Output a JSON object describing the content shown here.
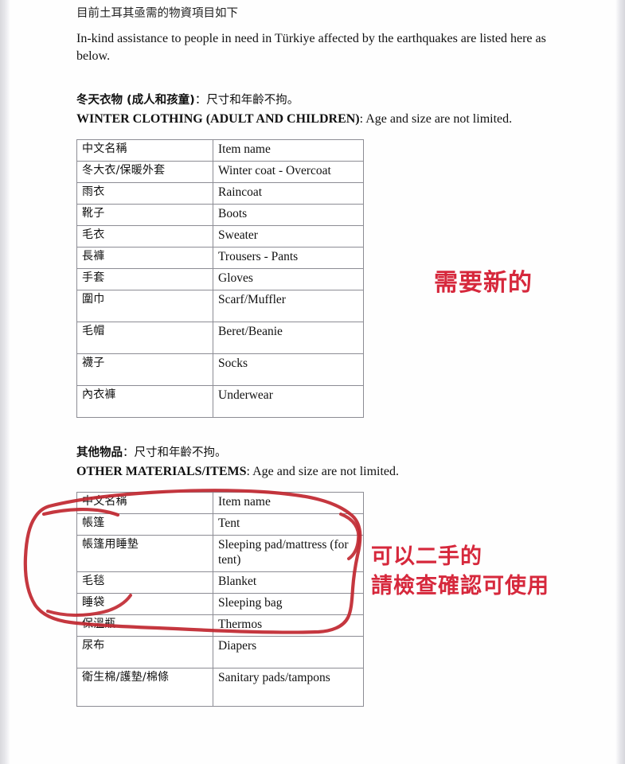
{
  "document": {
    "intro_cn": "目前土耳其亟需的物資項目如下",
    "intro_en": "In-kind assistance to people in need in Türkiye affected by the earthquakes are listed here as below."
  },
  "sections": [
    {
      "heading_cn_bold": "冬天衣物 (成人和孩童)",
      "heading_cn_rest": "：尺寸和年齡不拘。",
      "heading_en_bold": "WINTER CLOTHING (ADULT AND CHILDREN)",
      "heading_en_rest": ": Age and size are not limited.",
      "table": {
        "header": {
          "cn": "中文名稱",
          "en": "Item name"
        },
        "rows": [
          {
            "cn": "冬大衣/保暖外套",
            "en": "Winter coat - Overcoat"
          },
          {
            "cn": "雨衣",
            "en": "Raincoat"
          },
          {
            "cn": "靴子",
            "en": "Boots"
          },
          {
            "cn": "毛衣",
            "en": "Sweater"
          },
          {
            "cn": "長褲",
            "en": "Trousers - Pants"
          },
          {
            "cn": "手套",
            "en": "Gloves"
          },
          {
            "cn": "圍巾",
            "en": "Scarf/Muffler"
          },
          {
            "cn": "毛帽",
            "en": "Beret/Beanie"
          },
          {
            "cn": "襪子",
            "en": "Socks"
          },
          {
            "cn": "內衣褲",
            "en": "Underwear"
          }
        ]
      }
    },
    {
      "heading_cn_bold": "其他物品",
      "heading_cn_rest": "：尺寸和年齡不拘。",
      "heading_en_bold": "OTHER MATERIALS/ITEMS",
      "heading_en_rest": ": Age and size are not limited.",
      "table": {
        "header": {
          "cn": "中文名稱",
          "en": "Item name"
        },
        "rows": [
          {
            "cn": "帳篷",
            "en": "Tent"
          },
          {
            "cn": "帳篷用睡墊",
            "en": "Sleeping pad/mattress (for tent)"
          },
          {
            "cn": "毛毯",
            "en": "Blanket"
          },
          {
            "cn": "睡袋",
            "en": "Sleeping bag"
          },
          {
            "cn": "保溫瓶",
            "en": "Thermos"
          },
          {
            "cn": "尿布",
            "en": "Diapers"
          },
          {
            "cn": "衛生棉/護墊/棉條",
            "en": "Sanitary pads/tampons"
          }
        ]
      }
    }
  ],
  "annotations": {
    "need_new": "需要新的",
    "used_ok_line1": "可以二手的",
    "used_ok_line2": "請檢查確認可使用",
    "color": "#d6283c",
    "circle_color": "#c0262f"
  }
}
